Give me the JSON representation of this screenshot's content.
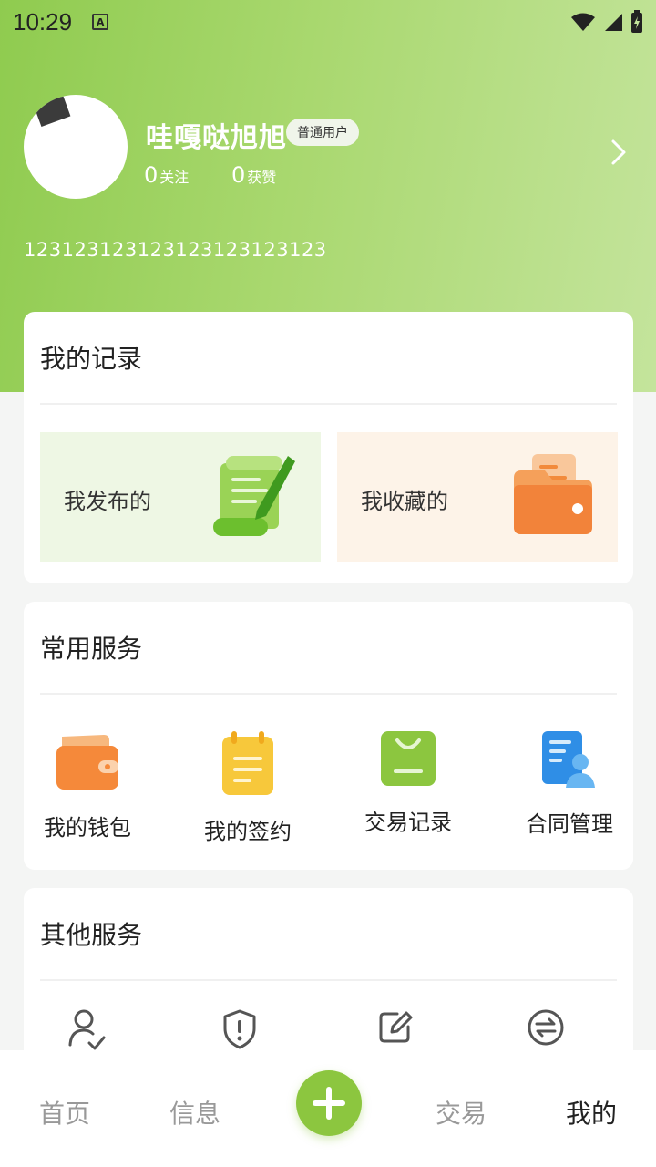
{
  "status_bar": {
    "time": "10:29",
    "notif_icon": "A"
  },
  "profile": {
    "name": "哇嘎哒旭旭",
    "badge": "普通用户",
    "follow_count": "0",
    "follow_label": "关注",
    "likes_count": "0",
    "likes_label": "获赞",
    "bio": "123123123123123123123123"
  },
  "records": {
    "title": "我的记录",
    "published": "我发布的",
    "favorites": "我收藏的"
  },
  "common_services": {
    "title": "常用服务",
    "items": [
      {
        "label": "我的钱包",
        "icon": "wallet-icon"
      },
      {
        "label": "我的签约",
        "icon": "clipboard-icon"
      },
      {
        "label": "交易记录",
        "icon": "bag-icon"
      },
      {
        "label": "合同管理",
        "icon": "contract-icon"
      }
    ]
  },
  "other_services": {
    "title": "其他服务",
    "icons": [
      "user-check-icon",
      "shield-alert-icon",
      "edit-icon",
      "exchange-icon"
    ]
  },
  "tabbar": {
    "home": "首页",
    "messages": "信息",
    "trade": "交易",
    "mine": "我的"
  },
  "colors": {
    "brand_green": "#8cc63f",
    "orange": "#f58b3c",
    "yellow": "#f7c83b",
    "blue": "#2f8ee6"
  }
}
